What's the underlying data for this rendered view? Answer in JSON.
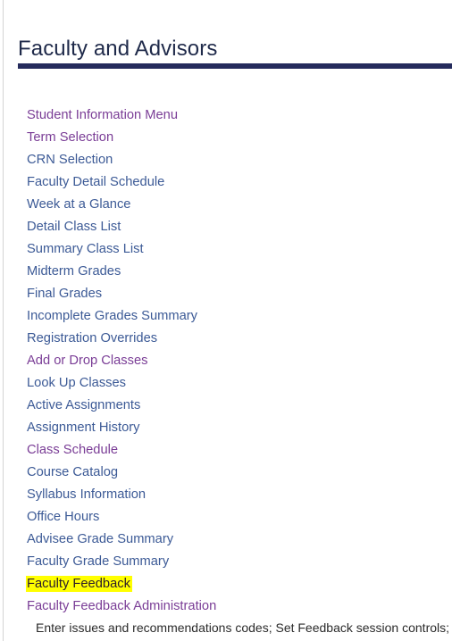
{
  "page": {
    "title": "Faculty and Advisors",
    "accent_color": "#252b5c",
    "link_color": "#3c5a96",
    "visited_link_color": "#7a3d96",
    "highlight_color": "#ffff00",
    "background_color": "#ffffff"
  },
  "menu": {
    "items": [
      {
        "label": "Student Information Menu",
        "state": "visited"
      },
      {
        "label": "Term Selection",
        "state": "visited"
      },
      {
        "label": "CRN Selection",
        "state": "link"
      },
      {
        "label": "Faculty Detail Schedule",
        "state": "link"
      },
      {
        "label": "Week at a Glance",
        "state": "link"
      },
      {
        "label": "Detail Class List",
        "state": "link"
      },
      {
        "label": "Summary Class List",
        "state": "link"
      },
      {
        "label": "Midterm Grades",
        "state": "link"
      },
      {
        "label": "Final Grades",
        "state": "link"
      },
      {
        "label": "Incomplete Grades Summary",
        "state": "link"
      },
      {
        "label": "Registration Overrides",
        "state": "link"
      },
      {
        "label": "Add or Drop Classes",
        "state": "visited"
      },
      {
        "label": "Look Up Classes",
        "state": "link"
      },
      {
        "label": "Active Assignments",
        "state": "link"
      },
      {
        "label": "Assignment History",
        "state": "link"
      },
      {
        "label": "Class Schedule",
        "state": "visited"
      },
      {
        "label": "Course Catalog",
        "state": "link"
      },
      {
        "label": "Syllabus Information",
        "state": "link"
      },
      {
        "label": "Office Hours",
        "state": "link"
      },
      {
        "label": "Advisee Grade Summary",
        "state": "link"
      },
      {
        "label": "Faculty Grade Summary",
        "state": "link"
      },
      {
        "label": "Faculty Feedback",
        "state": "highlighted"
      },
      {
        "label": "Faculty Feedback Administration",
        "state": "visited",
        "description": "Enter issues and recommendations codes; Set Feedback session controls;"
      }
    ]
  }
}
